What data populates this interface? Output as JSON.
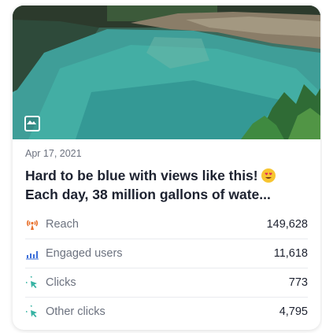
{
  "post": {
    "date": "Apr 17, 2021",
    "title_line1": "Hard to be blue with views like this!",
    "title_line2": "Each day, 38 million gallons of wate...",
    "emoji_icon": "heart-eyes-emoji-icon",
    "media_type_icon": "image-icon"
  },
  "metrics": [
    {
      "label": "Reach",
      "value": "149,628",
      "icon": "broadcast-icon",
      "color": "#e8712d"
    },
    {
      "label": "Engaged users",
      "value": "11,618",
      "icon": "bar-chart-icon",
      "color": "#3d6fd9"
    },
    {
      "label": "Clicks",
      "value": "773",
      "icon": "cursor-click-icon",
      "color": "#37b3a3"
    },
    {
      "label": "Other clicks",
      "value": "4,795",
      "icon": "cursor-click-icon",
      "color": "#37b3a3"
    }
  ]
}
